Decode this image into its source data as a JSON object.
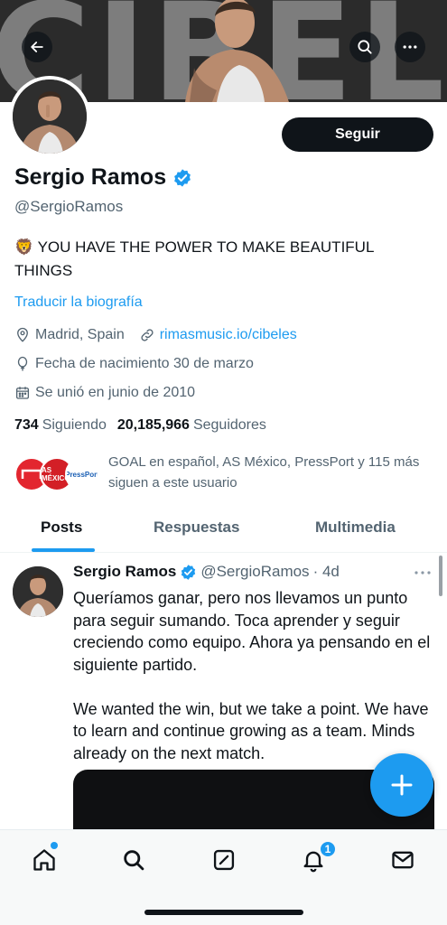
{
  "banner": {
    "text": "CIBELES",
    "back_icon": "arrow-left-icon",
    "search_icon": "search-icon",
    "more_icon": "more-horizontal-icon"
  },
  "profile": {
    "follow_label": "Seguir",
    "name": "Sergio Ramos",
    "handle": "@SergioRamos",
    "bio_emoji": "🦁",
    "bio": "YOU HAVE THE POWER TO MAKE BEAUTIFUL THINGS",
    "translate_label": "Traducir la biografía",
    "location": "Madrid, Spain",
    "website": "rimasmusic.io/cibeles",
    "birthday": "Fecha de nacimiento 30 de marzo",
    "joined": "Se unió en junio de 2010",
    "following_count": "734",
    "following_label": "Siguiendo",
    "followers_count": "20,185,966",
    "followers_label": "Seguidores",
    "known_followers_text": "GOAL en español, AS México, PressPort y 115 más siguen a este usuario",
    "known_avatars": [
      "GOAL",
      "AS MÉXICO",
      "PressPort"
    ]
  },
  "tabs": [
    {
      "label": "Posts",
      "active": true
    },
    {
      "label": "Respuestas",
      "active": false
    },
    {
      "label": "Multimedia",
      "active": false
    }
  ],
  "tweet": {
    "name": "Sergio Ramos",
    "handle": "@SergioRamos",
    "time": "· 4d",
    "text_es": "Queríamos ganar, pero nos llevamos un punto para seguir sumando. Toca aprender y seguir creciendo como equipo. Ahora ya pensando en el siguiente partido.",
    "text_en": "We wanted the win, but we take a point. We have to learn and continue growing as a team. Minds already on the next match."
  },
  "nav": {
    "items": [
      "home-icon",
      "search-icon",
      "grok-icon",
      "notifications-icon",
      "messages-icon"
    ],
    "notification_badge": "1"
  },
  "colors": {
    "accent": "#1d9bf0",
    "text": "#0f1419",
    "secondary": "#536471"
  }
}
